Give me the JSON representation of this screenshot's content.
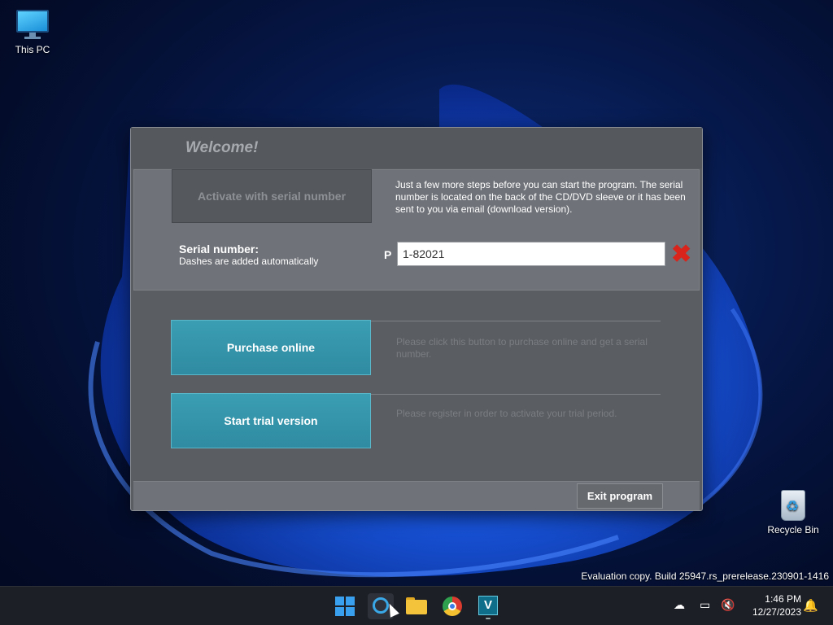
{
  "desktop": {
    "icons": [
      {
        "label": "This PC",
        "icon": "monitor-icon"
      },
      {
        "label": "Recycle Bin",
        "icon": "recycle-bin-icon"
      }
    ]
  },
  "dialog": {
    "title": "Welcome!",
    "activate_tab_label": "Activate with serial number",
    "intro_text": "Just a few more steps before you can start the program. The serial number is located on the back of the CD/DVD sleeve or it has been sent to you via email (download version).",
    "serial_label": "Serial number:",
    "serial_hint": "Dashes are added automatically",
    "serial_prefix": "P",
    "serial_value": "1-82021",
    "purchase_button": "Purchase online",
    "purchase_desc": "Please click this button to purchase online and get a serial number.",
    "trial_button": "Start trial version",
    "trial_desc": "Please register in order to activate your trial period.",
    "exit_button": "Exit program"
  },
  "watermark": "Evaluation copy. Build 25947.rs_prerelease.230901-1416",
  "taskbar": {
    "apps": [
      {
        "name": "start",
        "icon": "windows-logo-icon"
      },
      {
        "name": "search",
        "icon": "search-icon"
      },
      {
        "name": "file-explorer",
        "icon": "folder-icon"
      },
      {
        "name": "chrome",
        "icon": "chrome-icon"
      },
      {
        "name": "vegas",
        "icon": "v15-app-icon",
        "label": "V"
      }
    ],
    "time": "1:46 PM",
    "date": "12/27/2023"
  },
  "colors": {
    "accent_teal": "#3b9eb3",
    "dialog_gray": "#5a5d62",
    "clear_red": "#d8241a"
  }
}
